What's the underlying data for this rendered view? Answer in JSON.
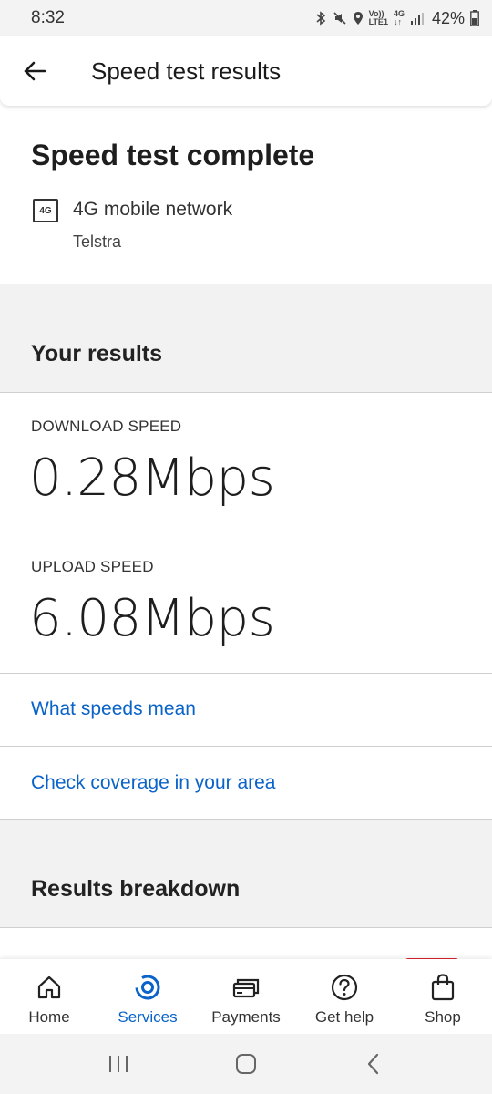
{
  "status_bar": {
    "time": "8:32",
    "network_top": "Vo))",
    "network_bottom": "LTE1",
    "generation": "4G",
    "battery": "42%"
  },
  "header": {
    "title": "Speed test results"
  },
  "complete": {
    "title": "Speed test complete",
    "network_icon_text": "4G",
    "network_name": "4G mobile network",
    "carrier": "Telstra"
  },
  "results": {
    "heading": "Your results",
    "download_label": "DOWNLOAD SPEED",
    "download_value": "0.28Mbps",
    "upload_label": "UPLOAD SPEED",
    "upload_value": "6.08Mbps"
  },
  "links": {
    "speeds_mean": "What speeds mean",
    "coverage": "Check coverage in your area"
  },
  "breakdown": {
    "heading": "Results breakdown"
  },
  "bottom_nav": {
    "home": "Home",
    "services": "Services",
    "payments": "Payments",
    "help": "Get help",
    "shop": "Shop"
  },
  "colors": {
    "accent": "#0a63c9",
    "active_tab_marker": "#d8252e"
  }
}
